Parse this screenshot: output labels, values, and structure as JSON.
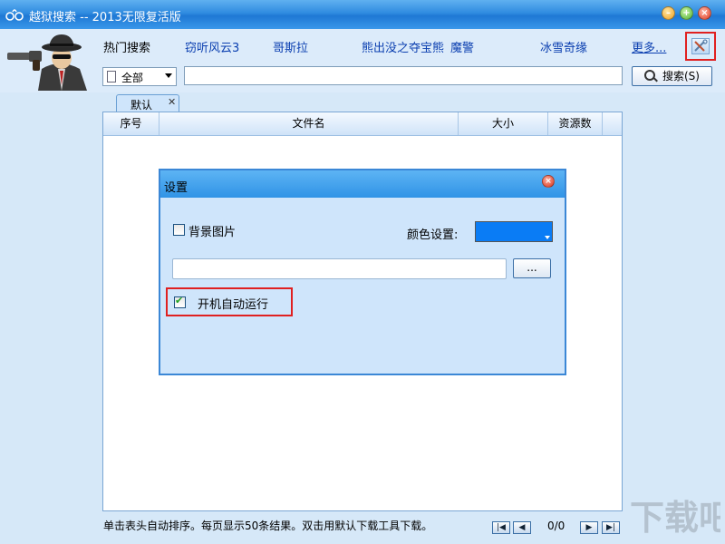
{
  "window": {
    "title": "越狱搜索 -- 2013无限复活版",
    "title_icon": "handcuffs-icon",
    "buttons": [
      "minimize-icon",
      "maximize-icon",
      "close-icon"
    ]
  },
  "header": {
    "hot_label": "热门搜索",
    "hot_links": [
      "窃听风云3",
      "哥斯拉",
      "熊出没之夺宝熊",
      "魔警",
      "冰雪奇缘"
    ],
    "more_link": "更多...",
    "tools_icon": "tools-icon",
    "scope_value": "全部",
    "search_value": "",
    "search_button": "搜索(S)",
    "accent_color": "#2f8be0"
  },
  "tab": {
    "label": "默认"
  },
  "table": {
    "columns": [
      "序号",
      "文件名",
      "大小",
      "资源数"
    ],
    "rows": []
  },
  "status": {
    "message": "单击表头自动排序。每页显示50条结果。双击用默认下载工具下载。",
    "page_info": "0/0"
  },
  "settings_dialog": {
    "title": "设置",
    "bg_image_label": "背景图片",
    "bg_image_checked": false,
    "color_label": "颜色设置:",
    "color_value": "#0a7cf5",
    "path_value": "",
    "browse_label": "...",
    "autorun_label": "开机自动运行",
    "autorun_checked": true
  }
}
